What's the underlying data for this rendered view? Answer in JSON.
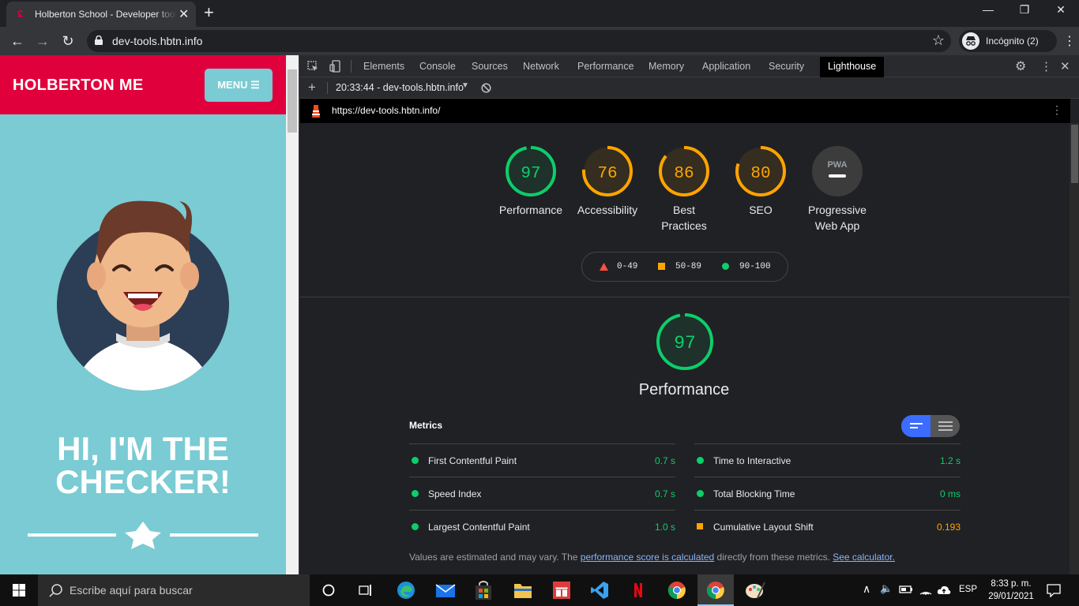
{
  "browser": {
    "tab_title": "Holberton School - Developer tools",
    "url": "dev-tools.hbtn.info",
    "profile": "Incógnito (2)"
  },
  "site": {
    "logo": "HOLBERTON ME",
    "menu_label": "MENU ☰",
    "hero_line1": "HI, I'M THE",
    "hero_line2": "CHECKER!"
  },
  "devtools": {
    "tabs": [
      "Elements",
      "Console",
      "Sources",
      "Network",
      "Performance",
      "Memory",
      "Application",
      "Security",
      "Lighthouse"
    ],
    "active_tab": "Lighthouse",
    "report_selector": "20:33:44 - dev-tools.hbtn.info",
    "report_url": "https://dev-tools.hbtn.info/"
  },
  "lighthouse": {
    "gauges": [
      {
        "score": "97",
        "label": "Performance",
        "color": "#0cce6b"
      },
      {
        "score": "76",
        "label": "Accessibility",
        "color": "#ffa400"
      },
      {
        "score": "86",
        "label": "Best Practices",
        "color": "#ffa400"
      },
      {
        "score": "80",
        "label": "SEO",
        "color": "#ffa400"
      },
      {
        "score": "PWA",
        "label": "Progressive Web App",
        "color": "#9aa0a6"
      }
    ],
    "legend": {
      "fail": "0-49",
      "average": "50-89",
      "pass": "90-100"
    },
    "category_score": "97",
    "category_title": "Performance",
    "metrics_title": "Metrics",
    "metrics_left": [
      {
        "name": "First Contentful Paint",
        "value": "0.7 s",
        "rating": "pass"
      },
      {
        "name": "Speed Index",
        "value": "0.7 s",
        "rating": "pass"
      },
      {
        "name": "Largest Contentful Paint",
        "value": "1.0 s",
        "rating": "pass"
      }
    ],
    "metrics_right": [
      {
        "name": "Time to Interactive",
        "value": "1.2 s",
        "rating": "pass"
      },
      {
        "name": "Total Blocking Time",
        "value": "0 ms",
        "rating": "pass"
      },
      {
        "name": "Cumulative Layout Shift",
        "value": "0.193",
        "rating": "average"
      }
    ],
    "note_prefix": "Values are estimated and may vary. The ",
    "note_link": "performance score is calculated",
    "note_middle": " directly from these metrics. ",
    "note_link2": "See calculator."
  },
  "taskbar": {
    "search_placeholder": "Escribe aquí para buscar",
    "language": "ESP",
    "time": "8:33 p. m.",
    "date": "29/01/2021"
  }
}
